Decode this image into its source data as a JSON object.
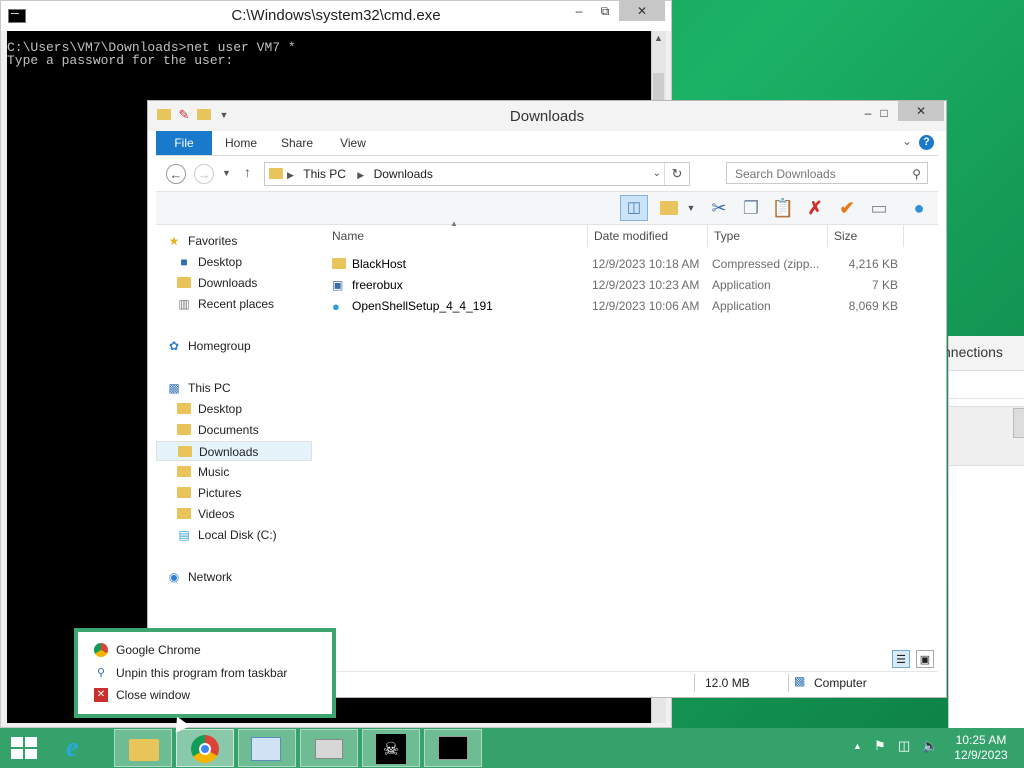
{
  "cmd": {
    "title": "C:\\Windows\\system32\\cmd.exe",
    "line1": "C:\\Users\\VM7\\Downloads>net user VM7 *",
    "line2": "Type a password for the user:"
  },
  "bg_window": {
    "title_fragment": "nnections"
  },
  "explorer": {
    "title": "Downloads",
    "tabs": [
      "File",
      "Home",
      "Share",
      "View"
    ],
    "breadcrumb": [
      "This PC",
      "Downloads"
    ],
    "search_placeholder": "Search Downloads",
    "nav": {
      "favorites": "Favorites",
      "fav_items": [
        "Desktop",
        "Downloads",
        "Recent places"
      ],
      "homegroup": "Homegroup",
      "thispc": "This PC",
      "pc_items": [
        "Desktop",
        "Documents",
        "Downloads",
        "Music",
        "Pictures",
        "Videos",
        "Local Disk (C:)"
      ],
      "network": "Network"
    },
    "columns": [
      "Name",
      "Date modified",
      "Type",
      "Size"
    ],
    "files": [
      {
        "name": "BlackHost",
        "date": "12/9/2023 10:18 AM",
        "type": "Compressed (zipp...",
        "size": "4,216 KB"
      },
      {
        "name": "freerobux",
        "date": "12/9/2023 10:23 AM",
        "type": "Application",
        "size": "7 KB"
      },
      {
        "name": "OpenShellSetup_4_4_191",
        "date": "12/9/2023 10:06 AM",
        "type": "Application",
        "size": "8,069 KB"
      }
    ],
    "status": {
      "size": "12.0 MB",
      "location": "Computer"
    }
  },
  "jumplist": {
    "items": [
      "Google Chrome",
      "Unpin this program from taskbar",
      "Close window"
    ]
  },
  "taskbar": {
    "time": "10:25 AM",
    "date": "12/9/2023"
  },
  "colors": {
    "accent": "#1979ca",
    "taskbar": "#35a26b"
  }
}
